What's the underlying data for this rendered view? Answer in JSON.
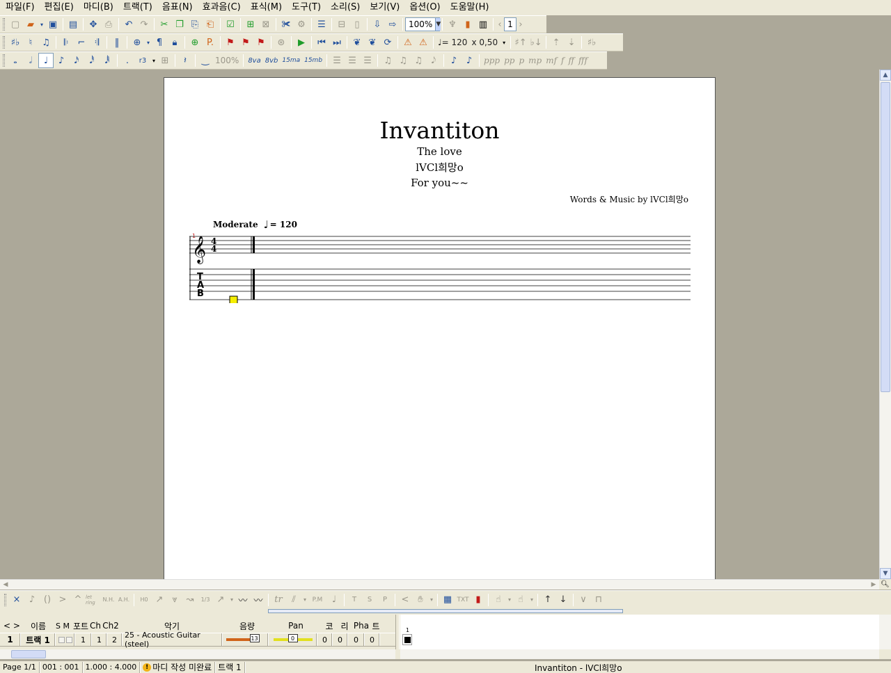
{
  "menu": [
    {
      "label": "파일(F)"
    },
    {
      "label": "편집(E)"
    },
    {
      "label": "마디(B)"
    },
    {
      "label": "트랙(T)"
    },
    {
      "label": "음표(N)"
    },
    {
      "label": "효과음(C)"
    },
    {
      "label": "표식(M)"
    },
    {
      "label": "도구(T)"
    },
    {
      "label": "소리(S)"
    },
    {
      "label": "보기(V)"
    },
    {
      "label": "옵션(O)"
    },
    {
      "label": "도움말(H)"
    }
  ],
  "toolbar1": {
    "zoom_value": "100%",
    "page_input": "1"
  },
  "toolbar2": {
    "tempo_value": "♩= 120",
    "speed_value": "x 0,50"
  },
  "toolbar3": {
    "dim_percent": "100%",
    "octave_labels": [
      "8va",
      "8vb",
      "15ma",
      "15mb"
    ],
    "dynamics": [
      "ppp",
      "pp",
      "p",
      "mp",
      "mf",
      "f",
      "ff",
      "fff"
    ]
  },
  "score": {
    "title": "Invantiton",
    "subtitle": "The love",
    "artist": "lVCl희망o",
    "album": "For you~~",
    "credit": "Words & Music by lVCl희망o",
    "tempo_label": "Moderate",
    "tempo_bpm": "= 120",
    "measure_number": "1",
    "time_signature": {
      "top": "4",
      "bottom": "4"
    },
    "tab_letters": [
      "T",
      "A",
      "B"
    ]
  },
  "fxbar": {
    "items": [
      "×",
      "♪",
      "()",
      ">",
      "^",
      "let ring",
      "N.H.",
      "A.H.",
      "H0",
      "↗",
      "⩔",
      "1/3",
      "tr",
      "P.M",
      "T",
      "S",
      "P",
      "<",
      "TXT"
    ]
  },
  "track_header": {
    "nav": "< >",
    "name": "이름",
    "sm": "S M",
    "port": "포트",
    "ch": "Ch",
    "ch2": "Ch2",
    "instrument": "악기",
    "volume": "음량",
    "pan": "Pan",
    "chorus": "코",
    "reverb": "리",
    "phaser": "Pha",
    "tremolo": "트"
  },
  "track_row": {
    "number": "1",
    "name": "트랙 1",
    "port": "1",
    "ch": "1",
    "ch2": "2",
    "instrument": "25 - Acoustic Guitar (steel)",
    "volume": "13",
    "volume_level": 0.81,
    "pan": "0",
    "pan_level": 0.5,
    "chorus": "0",
    "reverb": "0",
    "phaser": "0",
    "tremolo": "0",
    "measure_number": "1"
  },
  "status": {
    "page": "Page 1/1",
    "position": "001 : 001",
    "time": "1.000 : 4.000",
    "warning": "마디 작성 미완료",
    "track": "트랙 1",
    "title": "Invantiton - lVCl희망o"
  },
  "colors": {
    "chrome": "#ece9d8",
    "workspace": "#aca899",
    "cursor_yellow": "#f5ee00",
    "volume_bar": "#d0641a",
    "pan_bar": "#e2e01e"
  }
}
